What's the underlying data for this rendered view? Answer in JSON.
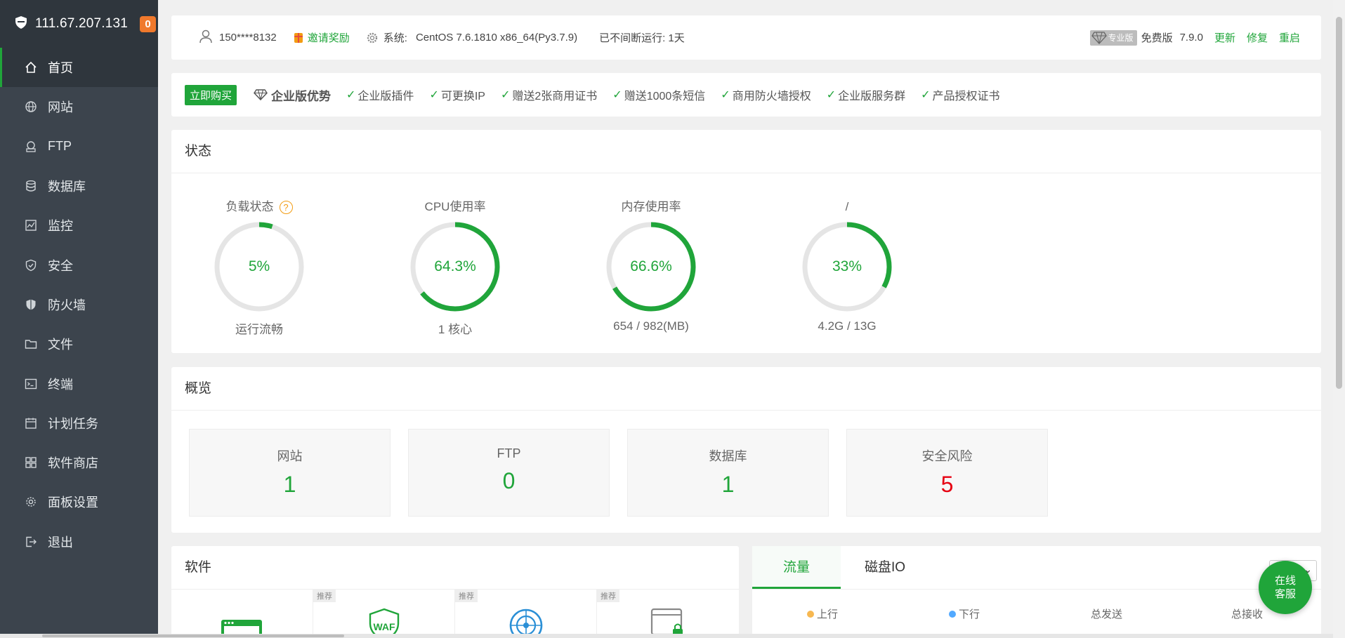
{
  "sidebar": {
    "ip": "111.67.207.131",
    "badge": "0",
    "items": [
      {
        "label": "首页"
      },
      {
        "label": "网站"
      },
      {
        "label": "FTP"
      },
      {
        "label": "数据库"
      },
      {
        "label": "监控"
      },
      {
        "label": "安全"
      },
      {
        "label": "防火墙"
      },
      {
        "label": "文件"
      },
      {
        "label": "终端"
      },
      {
        "label": "计划任务"
      },
      {
        "label": "软件商店"
      },
      {
        "label": "面板设置"
      },
      {
        "label": "退出"
      }
    ]
  },
  "topbar": {
    "user": "150****8132",
    "invite": "邀请奖励",
    "system_label": "系统:",
    "system_value": "CentOS 7.6.1810 x86_64(Py3.7.9)",
    "uptime": "已不间断运行: 1天",
    "pro_label": "专业版",
    "edition": "免费版",
    "version": "7.9.0",
    "update": "更新",
    "repair": "修复",
    "restart": "重启"
  },
  "banner": {
    "buy": "立即购买",
    "title": "企业版优势",
    "features": [
      "企业版插件",
      "可更换IP",
      "赠送2张商用证书",
      "赠送1000条短信",
      "商用防火墙授权",
      "企业版服务群",
      "产品授权证书"
    ]
  },
  "status": {
    "title": "状态",
    "gauges": [
      {
        "label": "负载状态",
        "help": "?",
        "value": "5%",
        "percent": 5,
        "sub": "运行流畅"
      },
      {
        "label": "CPU使用率",
        "value": "64.3%",
        "percent": 64.3,
        "sub": "1 核心"
      },
      {
        "label": "内存使用率",
        "value": "66.6%",
        "percent": 66.6,
        "sub": "654 / 982(MB)"
      },
      {
        "label": "/",
        "value": "33%",
        "percent": 33,
        "sub": "4.2G / 13G"
      }
    ]
  },
  "overview": {
    "title": "概览",
    "cards": [
      {
        "label": "网站",
        "value": "1"
      },
      {
        "label": "FTP",
        "value": "0"
      },
      {
        "label": "数据库",
        "value": "1"
      },
      {
        "label": "安全风险",
        "value": "5"
      }
    ]
  },
  "software": {
    "title": "软件",
    "tags": [
      "推荐",
      "推荐",
      "推荐"
    ]
  },
  "traffic": {
    "tabs": [
      "流量",
      "磁盘IO"
    ],
    "legend": {
      "up": "上行",
      "down": "下行",
      "total_sent": "总发送",
      "total_recv": "总接收"
    }
  },
  "chat": {
    "line1": "在线",
    "line2": "客服"
  },
  "colors": {
    "accent": "#20a53a",
    "sidebar": "#3c444d",
    "danger": "#e60012",
    "badge": "#f0792c"
  }
}
